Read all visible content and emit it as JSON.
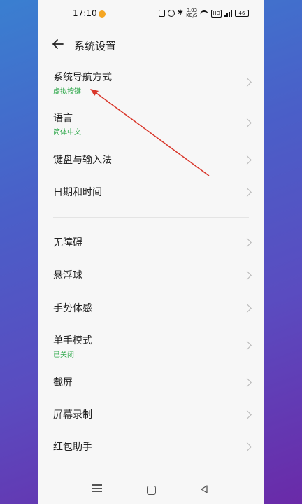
{
  "status_bar": {
    "time": "17:10",
    "network_speed_top": "0.03",
    "network_speed_bottom": "KB/S",
    "hd_badge": "HD",
    "battery": "46"
  },
  "header": {
    "title": "系统设置"
  },
  "items": [
    {
      "title": "系统导航方式",
      "subtitle": "虚拟按键"
    },
    {
      "title": "语言",
      "subtitle": "简体中文"
    },
    {
      "title": "键盘与输入法",
      "subtitle": ""
    },
    {
      "title": "日期和时间",
      "subtitle": ""
    },
    {
      "title": "无障碍",
      "subtitle": ""
    },
    {
      "title": "悬浮球",
      "subtitle": ""
    },
    {
      "title": "手势体感",
      "subtitle": ""
    },
    {
      "title": "单手模式",
      "subtitle": "已关闭"
    },
    {
      "title": "截屏",
      "subtitle": ""
    },
    {
      "title": "屏幕录制",
      "subtitle": ""
    },
    {
      "title": "红包助手",
      "subtitle": ""
    }
  ],
  "colors": {
    "accent_green": "#2ea84a",
    "annotation_red": "#d9372b"
  }
}
